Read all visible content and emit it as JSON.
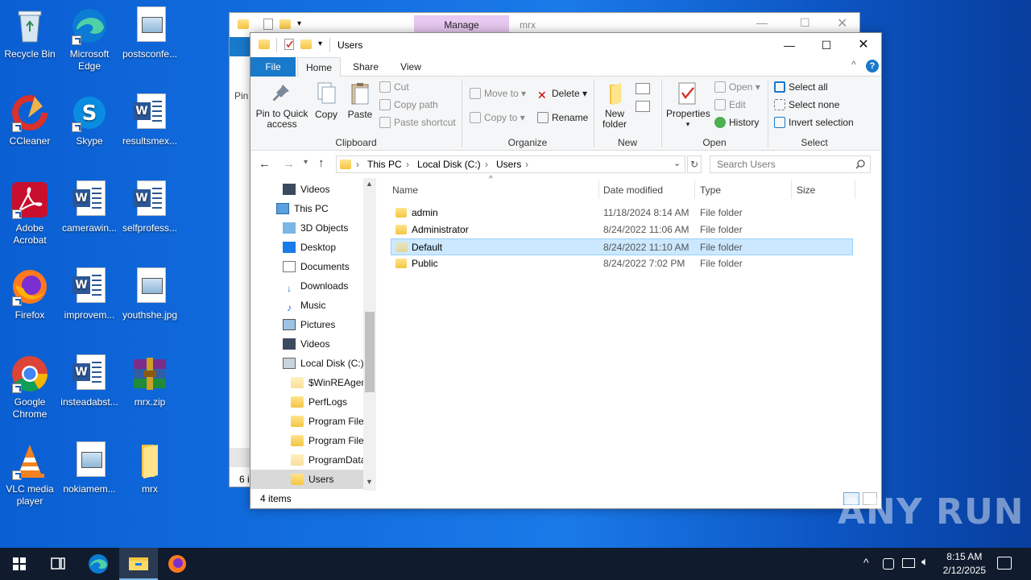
{
  "desktop": {
    "icons": [
      {
        "label": "Recycle Bin"
      },
      {
        "label": "Microsoft Edge"
      },
      {
        "label": "postsconfe..."
      },
      {
        "label": "CCleaner"
      },
      {
        "label": "Skype"
      },
      {
        "label": "resultsmex..."
      },
      {
        "label": "Adobe Acrobat"
      },
      {
        "label": "camerawin..."
      },
      {
        "label": "selfprofess..."
      },
      {
        "label": "Firefox"
      },
      {
        "label": "improvem..."
      },
      {
        "label": "youthshe.jpg"
      },
      {
        "label": "Google Chrome"
      },
      {
        "label": "insteadabst..."
      },
      {
        "label": "mrx.zip"
      },
      {
        "label": "VLC media player"
      },
      {
        "label": "nokiamem..."
      },
      {
        "label": "mrx"
      }
    ]
  },
  "bg_window": {
    "manage_label": "Manage",
    "title": "mrx",
    "status_partial": "6 i",
    "nav_partial": "Pin"
  },
  "window": {
    "title": "Users",
    "tabs": {
      "file": "File",
      "home": "Home",
      "share": "Share",
      "view": "View"
    },
    "clipboard": {
      "pin_line1": "Pin to Quick",
      "pin_line2": "access",
      "copy": "Copy",
      "paste": "Paste",
      "cut": "Cut",
      "copy_path": "Copy path",
      "paste_shortcut": "Paste shortcut",
      "group": "Clipboard"
    },
    "organize": {
      "move_to": "Move to",
      "copy_to": "Copy to",
      "delete": "Delete",
      "rename": "Rename",
      "group": "Organize"
    },
    "new": {
      "new_folder_1": "New",
      "new_folder_2": "folder",
      "group": "New"
    },
    "open": {
      "properties": "Properties",
      "open": "Open",
      "edit": "Edit",
      "history": "History",
      "group": "Open"
    },
    "select": {
      "select_all": "Select all",
      "select_none": "Select none",
      "invert": "Invert selection",
      "group": "Select"
    },
    "address": {
      "crumbs": [
        "This PC",
        "Local Disk (C:)",
        "Users"
      ]
    },
    "search": {
      "placeholder": "Search Users"
    },
    "nav": [
      {
        "label": "Videos"
      },
      {
        "label": "This PC"
      },
      {
        "label": "3D Objects"
      },
      {
        "label": "Desktop"
      },
      {
        "label": "Documents"
      },
      {
        "label": "Downloads"
      },
      {
        "label": "Music"
      },
      {
        "label": "Pictures"
      },
      {
        "label": "Videos"
      },
      {
        "label": "Local Disk (C:)"
      },
      {
        "label": "$WinREAgent"
      },
      {
        "label": "PerfLogs"
      },
      {
        "label": "Program Files"
      },
      {
        "label": "Program Files"
      },
      {
        "label": "ProgramData"
      },
      {
        "label": "Users"
      }
    ],
    "columns": {
      "name": "Name",
      "date": "Date modified",
      "type": "Type",
      "size": "Size"
    },
    "files": [
      {
        "name": "admin",
        "date": "11/18/2024 8:14 AM",
        "type": "File folder"
      },
      {
        "name": "Administrator",
        "date": "8/24/2022 11:06 AM",
        "type": "File folder"
      },
      {
        "name": "Default",
        "date": "8/24/2022 11:10 AM",
        "type": "File folder"
      },
      {
        "name": "Public",
        "date": "8/24/2022 7:02 PM",
        "type": "File folder"
      }
    ],
    "status": "4 items"
  },
  "taskbar": {
    "time": "8:15 AM",
    "date": "2/12/2025"
  },
  "watermark": "ANY RUN",
  "colors": {
    "desktop": "#1473e6",
    "selection": "#cce8ff",
    "file_tab": "#1979ca",
    "manage_tab": "#e8c9f1",
    "taskbar": "#101b2d"
  }
}
